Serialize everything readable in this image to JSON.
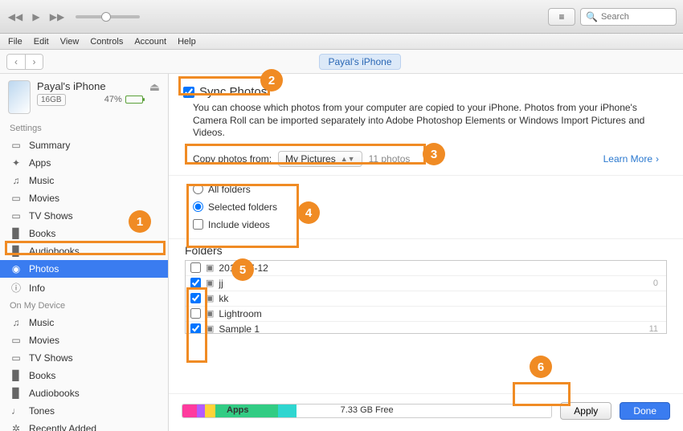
{
  "window": {
    "minimize": "─",
    "maximize": "▢",
    "close": "✕"
  },
  "toolbar": {
    "search_placeholder": "Search"
  },
  "menubar": [
    "File",
    "Edit",
    "View",
    "Controls",
    "Account",
    "Help"
  ],
  "device_pill": "Payal's iPhone",
  "device": {
    "name": "Payal's iPhone",
    "capacity": "16GB",
    "battery_pct": "47%"
  },
  "sidebar": {
    "settings_header": "Settings",
    "settings": [
      {
        "icon": "▭",
        "label": "Summary"
      },
      {
        "icon": "✦",
        "label": "Apps"
      },
      {
        "icon": "♫",
        "label": "Music"
      },
      {
        "icon": "▭",
        "label": "Movies"
      },
      {
        "icon": "▭",
        "label": "TV Shows"
      },
      {
        "icon": "▉",
        "label": "Books"
      },
      {
        "icon": "▉",
        "label": "Audiobooks"
      },
      {
        "icon": "◉",
        "label": "Photos"
      },
      {
        "icon": "ⓘ",
        "label": "Info"
      }
    ],
    "device_header": "On My Device",
    "ondevice": [
      {
        "icon": "♫",
        "label": "Music"
      },
      {
        "icon": "▭",
        "label": "Movies"
      },
      {
        "icon": "▭",
        "label": "TV Shows"
      },
      {
        "icon": "▉",
        "label": "Books"
      },
      {
        "icon": "▉",
        "label": "Audiobooks"
      },
      {
        "icon": "♩",
        "label": "Tones"
      },
      {
        "icon": "✲",
        "label": "Recently Added"
      }
    ]
  },
  "sync": {
    "checkbox_label": "Sync Photos",
    "desc": "You can choose which photos from your computer are copied to your iPhone. Photos from your iPhone's Camera Roll can be imported separately into Adobe Photoshop Elements or Windows Import Pictures and Videos.",
    "copy_from_label": "Copy photos from:",
    "copy_from_value": "My Pictures",
    "count": "11 photos",
    "learn_more": "Learn More",
    "opt_all": "All folders",
    "opt_selected": "Selected folders",
    "opt_video": "Include videos",
    "folders_header": "Folders",
    "folders": [
      {
        "checked": false,
        "name": "2016-07-12",
        "count": ""
      },
      {
        "checked": true,
        "name": "jj",
        "count": "0"
      },
      {
        "checked": true,
        "name": "kk",
        "count": ""
      },
      {
        "checked": false,
        "name": "Lightroom",
        "count": ""
      },
      {
        "checked": true,
        "name": "Sample 1",
        "count": "11"
      }
    ]
  },
  "storage": {
    "segments": [
      {
        "color": "#ff3b9e",
        "width": "4%",
        "label": ""
      },
      {
        "color": "#b35cff",
        "width": "2%",
        "label": ""
      },
      {
        "color": "#ffd338",
        "width": "3%",
        "label": ""
      },
      {
        "color": "#32cc84",
        "width": "17%",
        "label": "Apps"
      },
      {
        "color": "#2fd6d0",
        "width": "5%",
        "label": ""
      },
      {
        "color": "#ffffff",
        "width": "69%",
        "label": ""
      }
    ],
    "free": "7.33 GB Free"
  },
  "buttons": {
    "apply": "Apply",
    "done": "Done"
  },
  "annotations": [
    "1",
    "2",
    "3",
    "4",
    "5",
    "6"
  ]
}
